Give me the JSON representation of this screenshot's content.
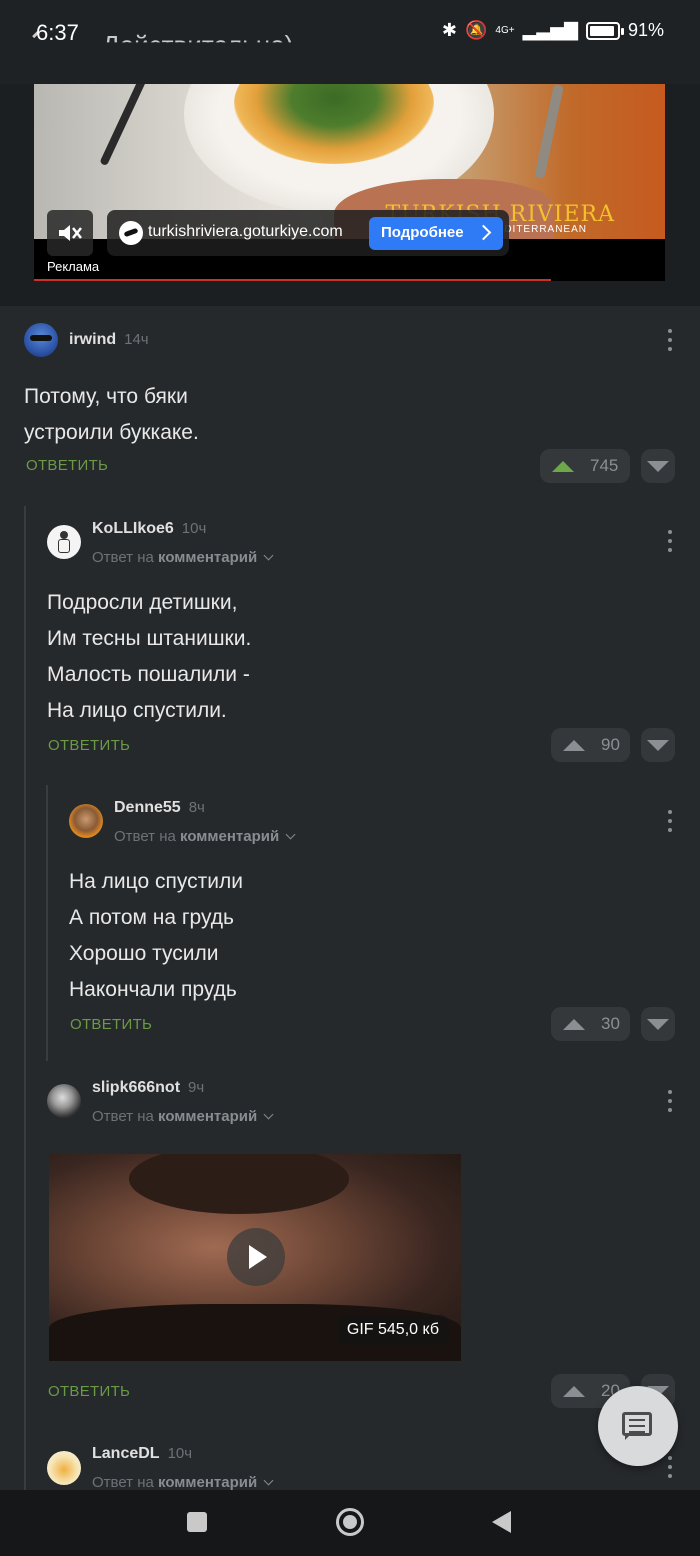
{
  "status": {
    "time": "6:37",
    "battery": "91%",
    "battery_level": 0.91,
    "network": "4G+"
  },
  "behind_title": "Действительно)",
  "ad": {
    "domain": "turkishriviera.goturkiye.com",
    "cta": "Подробнее",
    "label": "Реклама",
    "brand": "TURKISH RIVIERA",
    "brand_sub": "MEDITERRANEAN",
    "progress": 0.82
  },
  "comments": [
    {
      "user": "irwind",
      "time": "14ч",
      "lines": [
        "Потому, что бяки",
        "устроили буккаке."
      ],
      "reply": "ОТВЕТИТЬ",
      "votes": "745"
    },
    {
      "user": "KoLLIkoe6",
      "time": "10ч",
      "reply_to_prefix": "Ответ на",
      "reply_to_target": "комментарий",
      "lines": [
        "Подросли детишки,",
        "Им тесны штанишки.",
        "Малость пошалили -",
        "На лицо спустили."
      ],
      "reply": "ОТВЕТИТЬ",
      "votes": "90"
    },
    {
      "user": "Denne55",
      "time": "8ч",
      "reply_to_prefix": "Ответ на",
      "reply_to_target": "комментарий",
      "lines": [
        "На лицо спустили",
        "А потом на грудь",
        "Хорошо тусили",
        "Накончали прудь"
      ],
      "reply": "ОТВЕТИТЬ",
      "votes": "30"
    },
    {
      "user": "slipk666not",
      "time": "9ч",
      "reply_to_prefix": "Ответ на",
      "reply_to_target": "комментарий",
      "gif_size": "GIF 545,0 кб",
      "reply": "ОТВЕТИТЬ",
      "votes": "20"
    },
    {
      "user": "LanceDL",
      "time": "10ч",
      "reply_to_prefix": "Ответ на",
      "reply_to_target": "комментарий"
    }
  ]
}
